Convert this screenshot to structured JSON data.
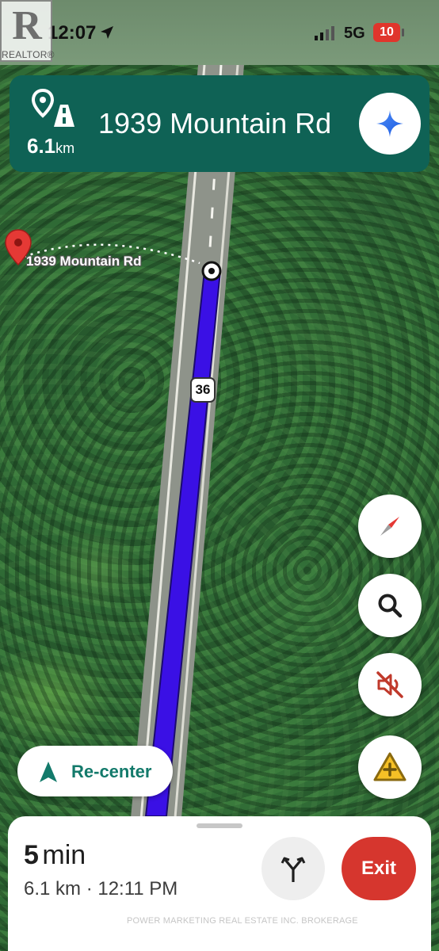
{
  "status_bar": {
    "time": "12:07",
    "network": "5G",
    "battery": "10",
    "location_icon": "location-arrow-icon",
    "signal_icon": "cellular-signal-icon"
  },
  "watermark": {
    "logo_letter": "R",
    "logo_label": "REALTOR®",
    "brokerage": "POWER MARKETING REAL ESTATE INC. BROKERAGE"
  },
  "navigation": {
    "street": "1939 Mountain Rd",
    "distance_value": "6.1",
    "distance_unit": "km",
    "turn_icon": "destination-on-road-icon",
    "header_color": "#0f6255"
  },
  "map": {
    "destination_label": "1939 Mountain Rd",
    "route_shield": "36",
    "route_color": "#3a10e5",
    "pin_color": "#e53935"
  },
  "controls": {
    "compass_icon": "compass-icon",
    "search_icon": "search-icon",
    "mute_icon": "sound-off-icon",
    "report_icon": "report-incident-icon",
    "recenter_label": "Re-center"
  },
  "trip": {
    "duration_value": "5",
    "duration_unit": "min",
    "details": "6.1 km · 12:11 PM",
    "exit_label": "Exit",
    "alternate_routes_icon": "alternate-routes-icon",
    "exit_color": "#d6362e"
  }
}
